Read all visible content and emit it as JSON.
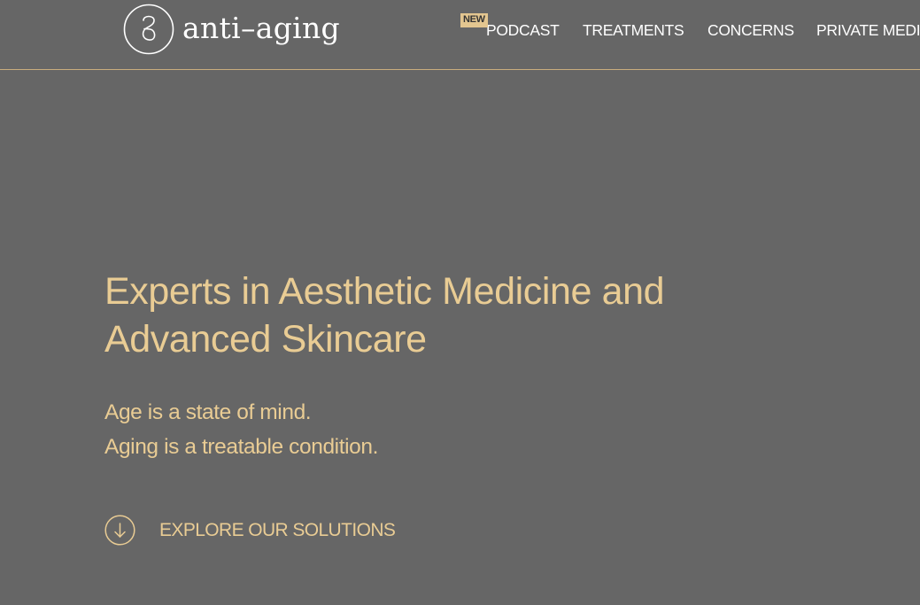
{
  "header": {
    "logo_text": "anti–aging",
    "nav": {
      "badge": "NEW",
      "items": [
        {
          "label": "PODCAST"
        },
        {
          "label": "TREATMENTS"
        },
        {
          "label": "CONCERNS"
        },
        {
          "label": "PRIVATE MEDI"
        }
      ]
    }
  },
  "hero": {
    "title": "Experts in Aesthetic Medicine and Advanced Skincare",
    "subtitle_lines": [
      "Age is a state of mind.",
      "Aging is a treatable condition."
    ],
    "cta_label": "EXPLORE OUR SOLUTIONS",
    "cta_icon": "arrow-down-circle-icon"
  },
  "colors": {
    "background": "#666666",
    "accent": "#e9cc94",
    "badge": "#e3c690",
    "divider": "#c9ad7e",
    "nav_text": "#ffffff"
  }
}
